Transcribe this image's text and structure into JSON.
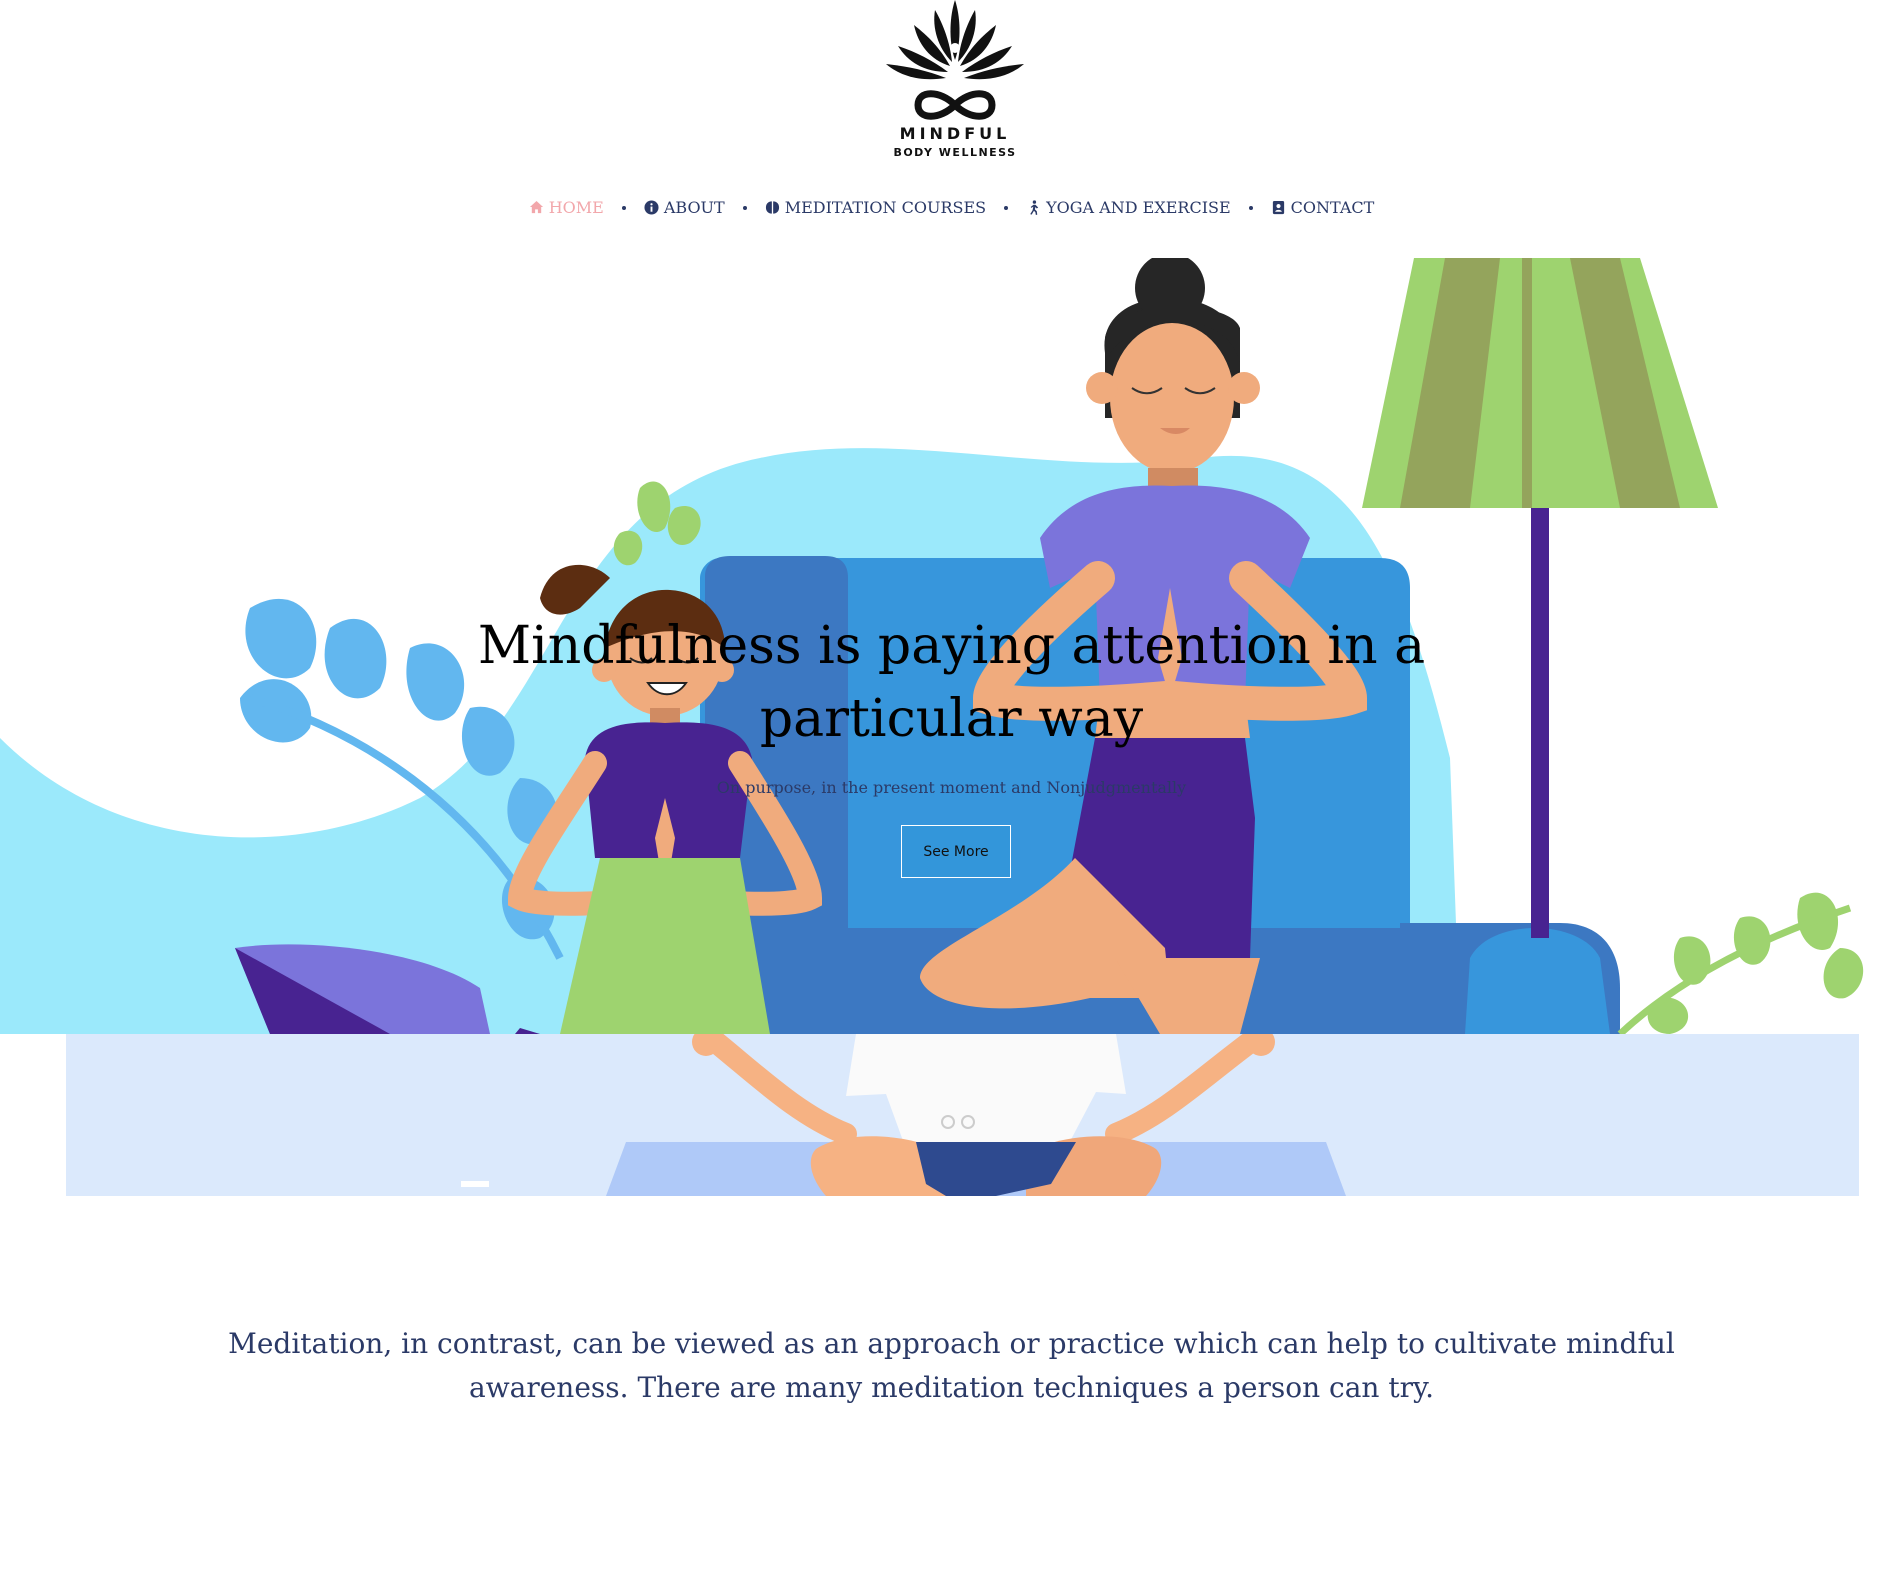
{
  "brand": {
    "line1": "MINDFUL",
    "line2": "BODY WELLNESS"
  },
  "nav": {
    "items": [
      {
        "label": "HOME",
        "icon": "home-icon",
        "active": true
      },
      {
        "label": "ABOUT",
        "icon": "info-icon",
        "active": false
      },
      {
        "label": "MEDITATION COURSES",
        "icon": "brain-icon",
        "active": false
      },
      {
        "label": "YOGA AND EXERCISE",
        "icon": "walking-person-icon",
        "active": false
      },
      {
        "label": "CONTACT",
        "icon": "contact-card-icon",
        "active": false
      }
    ]
  },
  "hero": {
    "title_line1": "Mindfulness is paying attention in a",
    "title_line2": "particular way",
    "subtitle": "On purpose, in the present moment and Nonjudgmentally",
    "button_label": "See More"
  },
  "body": {
    "text": "Meditation, in contrast, can be viewed as an approach or practice which can help to cultivate mindful awareness. There are many meditation techniques a person can try."
  },
  "colors": {
    "nav_text": "#2b3a67",
    "nav_active": "#f2a7ab",
    "hero_sky": "#9be9fb",
    "sofa_blue": "#3796dc",
    "lamp_green": "#9ed36f",
    "purple": "#482391",
    "floor": "#dbe9fc"
  }
}
